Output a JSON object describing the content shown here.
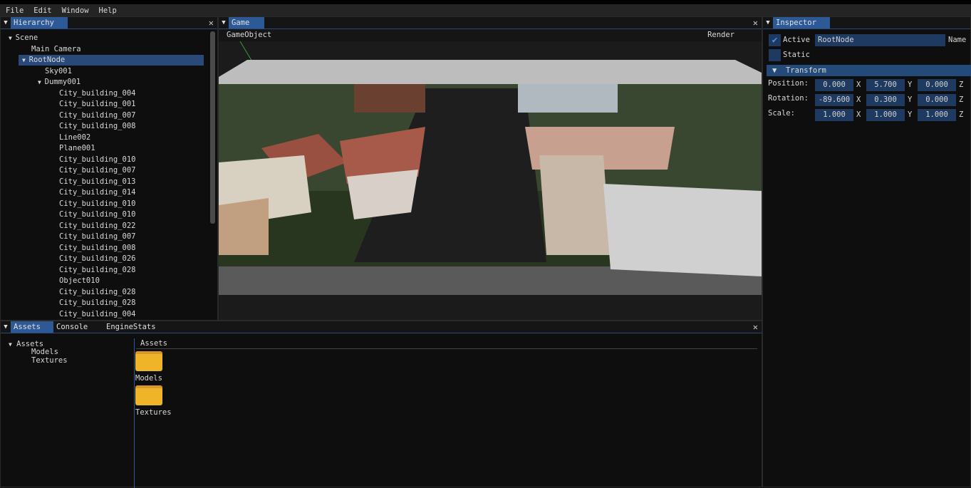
{
  "menu": [
    "File",
    "Edit",
    "Window",
    "Help"
  ],
  "hierarchy": {
    "tab": "Hierarchy",
    "items": [
      {
        "label": "Scene",
        "depth": 0,
        "arrow": true
      },
      {
        "label": "Main Camera",
        "depth": 1,
        "arrow": false
      },
      {
        "label": "RootNode",
        "depth": 1,
        "arrow": true,
        "selected": true
      },
      {
        "label": "Sky001",
        "depth": 2,
        "arrow": false
      },
      {
        "label": "Dummy001",
        "depth": 2,
        "arrow": true
      },
      {
        "label": "City_building_004",
        "depth": 3
      },
      {
        "label": "City_building_001",
        "depth": 3
      },
      {
        "label": "City_building_007",
        "depth": 3
      },
      {
        "label": "City_building_008",
        "depth": 3
      },
      {
        "label": "Line002",
        "depth": 3
      },
      {
        "label": "Plane001",
        "depth": 3
      },
      {
        "label": "City_building_010",
        "depth": 3
      },
      {
        "label": "City_building_007",
        "depth": 3
      },
      {
        "label": "City_building_013",
        "depth": 3
      },
      {
        "label": "City_building_014",
        "depth": 3
      },
      {
        "label": "City_building_010",
        "depth": 3
      },
      {
        "label": "City_building_010",
        "depth": 3
      },
      {
        "label": "City_building_022",
        "depth": 3
      },
      {
        "label": "City_building_007",
        "depth": 3
      },
      {
        "label": "City_building_008",
        "depth": 3
      },
      {
        "label": "City_building_026",
        "depth": 3
      },
      {
        "label": "City_building_028",
        "depth": 3
      },
      {
        "label": "Object010",
        "depth": 3
      },
      {
        "label": "City_building_028",
        "depth": 3
      },
      {
        "label": "City_building_028",
        "depth": 3
      },
      {
        "label": "City_building_004",
        "depth": 3
      }
    ]
  },
  "game": {
    "tab": "Game",
    "menu_left": "GameObject",
    "menu_right": "Render"
  },
  "inspector": {
    "tab": "Inspector",
    "active_label": "Active",
    "active_checked": true,
    "name_value": "RootNode",
    "name_label": "Name",
    "static_label": "Static",
    "static_checked": false,
    "transform_header": "Transform",
    "rows": [
      {
        "label": "Position:",
        "x": "0.000",
        "y": "5.700",
        "z": "0.000"
      },
      {
        "label": "Rotation:",
        "x": "-89.600",
        "y": "0.300",
        "z": "0.000"
      },
      {
        "label": "Scale:",
        "x": "1.000",
        "y": "1.000",
        "z": "1.000"
      }
    ],
    "axes": [
      "X",
      "Y",
      "Z"
    ]
  },
  "bottom": {
    "tabs": [
      "Assets",
      "Console",
      "EngineStats"
    ],
    "tree": {
      "root": "Assets",
      "children": [
        "Models",
        "Textures"
      ]
    },
    "content_header": "Assets",
    "folders": [
      "Models",
      "Textures"
    ]
  },
  "colors": {
    "accent": "#2d5a96",
    "folder": "#f0b429",
    "check": "#4a8ee0"
  }
}
